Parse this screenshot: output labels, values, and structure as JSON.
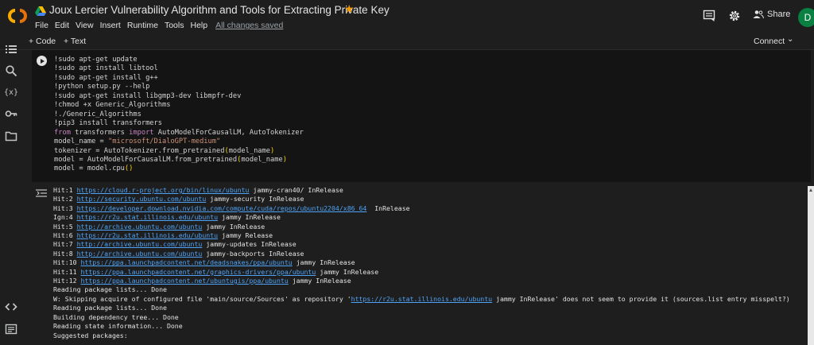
{
  "header": {
    "title": "Joux Lercier Vulnerability Algorithm and Tools for Extracting Private Key",
    "menu": [
      "File",
      "Edit",
      "View",
      "Insert",
      "Runtime",
      "Tools",
      "Help"
    ],
    "saved_status": "All changes saved",
    "share_label": "Share",
    "avatar_letter": "D"
  },
  "toolbar": {
    "add_code": "+ Code",
    "add_text": "+ Text",
    "connect": "Connect"
  },
  "cell": {
    "code_lines": [
      "!sudo apt-get update",
      "!sudo apt install libtool",
      "!sudo apt-get install g++",
      "!python setup.py --help",
      "!sudo apt-get install libgmp3-dev libmpfr-dev",
      "!chmod +x Generic_Algorithms",
      "!./Generic_Algorithms",
      "!pip3 install transformers",
      "from transformers import AutoModelForCausalLM, AutoTokenizer",
      "model_name = \"microsoft/DialoGPT-medium\"",
      "tokenizer = AutoTokenizer.from_pretrained(model_name)",
      "model = AutoModelForCausalLM.from_pretrained(model_name)",
      "model = model.cpu()"
    ]
  },
  "output": {
    "lines": [
      {
        "pre": "Hit:1 ",
        "link": "https://cloud.r-project.org/bin/linux/ubuntu",
        "post": " jammy-cran40/ InRelease"
      },
      {
        "pre": "Hit:2 ",
        "link": "http://security.ubuntu.com/ubuntu",
        "post": " jammy-security InRelease"
      },
      {
        "pre": "Hit:3 ",
        "link": "https://developer.download.nvidia.com/compute/cuda/repos/ubuntu2204/x86_64",
        "post": "  InRelease"
      },
      {
        "pre": "Ign:4 ",
        "link": "https://r2u.stat.illinois.edu/ubuntu",
        "post": " jammy InRelease"
      },
      {
        "pre": "Hit:5 ",
        "link": "http://archive.ubuntu.com/ubuntu",
        "post": " jammy InRelease"
      },
      {
        "pre": "Hit:6 ",
        "link": "https://r2u.stat.illinois.edu/ubuntu",
        "post": " jammy Release"
      },
      {
        "pre": "Hit:7 ",
        "link": "http://archive.ubuntu.com/ubuntu",
        "post": " jammy-updates InRelease"
      },
      {
        "pre": "Hit:8 ",
        "link": "http://archive.ubuntu.com/ubuntu",
        "post": " jammy-backports InRelease"
      },
      {
        "pre": "Hit:10 ",
        "link": "https://ppa.launchpadcontent.net/deadsnakes/ppa/ubuntu",
        "post": " jammy InRelease"
      },
      {
        "pre": "Hit:11 ",
        "link": "https://ppa.launchpadcontent.net/graphics-drivers/ppa/ubuntu",
        "post": " jammy InRelease"
      },
      {
        "pre": "Hit:12 ",
        "link": "https://ppa.launchpadcontent.net/ubuntugis/ppa/ubuntu",
        "post": " jammy InRelease"
      },
      {
        "pre": "Reading package lists... Done",
        "link": "",
        "post": ""
      },
      {
        "pre": "W: Skipping acquire of configured file 'main/source/Sources' as repository '",
        "link": "https://r2u.stat.illinois.edu/ubuntu",
        "post": " jammy InRelease' does not seem to provide it (sources.list entry misspelt?)"
      },
      {
        "pre": "Reading package lists... Done",
        "link": "",
        "post": ""
      },
      {
        "pre": "Building dependency tree... Done",
        "link": "",
        "post": ""
      },
      {
        "pre": "Reading state information... Done",
        "link": "",
        "post": ""
      },
      {
        "pre": "Suggested packages:",
        "link": "",
        "post": ""
      }
    ]
  },
  "icons": {
    "logo": "colab-logo",
    "drive": "drive-icon",
    "star": "star-icon",
    "comment": "comment-icon",
    "settings": "gear-icon",
    "share": "people-icon",
    "sidebar": [
      "table-of-contents-icon",
      "search-icon",
      "variables-icon",
      "secrets-key-icon",
      "folder-icon",
      "code-snippets-icon",
      "terminal-icon"
    ]
  },
  "colors": {
    "star": "#f29900",
    "avatar_bg": "#0b8043",
    "link": "#4fa3f7"
  }
}
